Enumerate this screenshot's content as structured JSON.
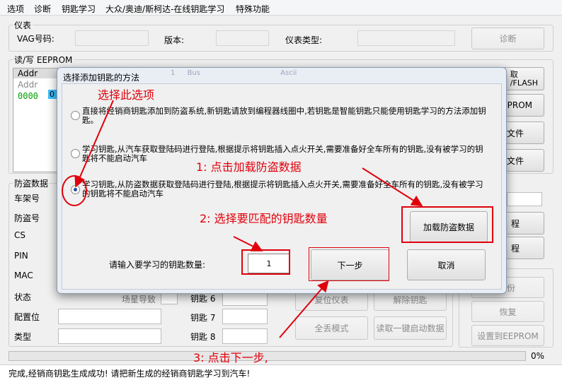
{
  "menu": [
    "选项",
    "诊断",
    "钥匙学习",
    "大众/奥迪/斯柯达-在线钥匙学习",
    "特殊功能"
  ],
  "meter_group": {
    "title": "仪表",
    "vag_label": "VAG号码:",
    "version_label": "版本:",
    "type_label": "仪表类型:",
    "diagnose_button": "诊断"
  },
  "eeprom_group": {
    "title": "读/写 EEPROM",
    "col_addr": "Addr",
    "row_addr": "0000",
    "row_val": "0",
    "bg_header_cols": [
      "1",
      "Bus",
      "Ascii"
    ],
    "right_buttons": [
      "取\n/FLASH",
      "EPROM",
      "文件",
      "文件"
    ]
  },
  "antitheft_group": {
    "title": "防盗数据",
    "labels": [
      "车架号",
      "防盗号",
      "CS",
      "PIN",
      "MAC",
      "状态",
      "配置位",
      "类型"
    ],
    "partial_label": "场星导致",
    "key_labels": [
      "钥匙 6",
      "钥匙 7",
      "钥匙 8"
    ],
    "right_partial": [
      "程",
      "程",
      "份"
    ]
  },
  "bottom_buttons": {
    "reset_meter": "复位仪表",
    "unlock_key": "解除钥匙",
    "all_lost": "全丢模式",
    "read_one_key": "读取一键启动数据",
    "restore": "恢复",
    "set_eeprom": "设置到EEPROM"
  },
  "progress": {
    "value": 0,
    "text": "0%"
  },
  "status_text": "完成,经销商钥匙生成成功! 请把新生成的经销商钥匙学习到汽车!",
  "dialog": {
    "title": "选择添加钥匙的方法",
    "options": [
      {
        "text": "直接将经销商钥匙添加到防盗系统,新钥匙请放到编程器线圈中,若钥匙是智能钥匙只能使用钥匙学习的方法添加钥匙。",
        "selected": false
      },
      {
        "text": "学习钥匙,从汽车获取登陆码进行登陆,根据提示将钥匙插入点火开关,需要准备好全车所有的钥匙,没有被学习的钥匙将不能启动汽车",
        "selected": false
      },
      {
        "text": "学习钥匙,从防盗数据获取登陆码进行登陆,根据提示将钥匙插入点火开关,需要准备好全车所有的钥匙,没有被学习的钥匙将不能启动汽车",
        "selected": true
      }
    ],
    "load_button": "加载防盗数据",
    "key_count_label": "请输入要学习的钥匙数量:",
    "key_count_value": "1",
    "next_button": "下一步",
    "cancel_button": "取消"
  },
  "annotations": {
    "select_option": "选择此选项",
    "step1": "1: 点击加载防盗数据",
    "step2": "2: 选择要匹配的钥匙数量",
    "step3": "3: 点击下一步,"
  },
  "colors": {
    "annotation": "#e0000b",
    "selection": "#1d4e9b",
    "hex_value": "#00a000"
  }
}
